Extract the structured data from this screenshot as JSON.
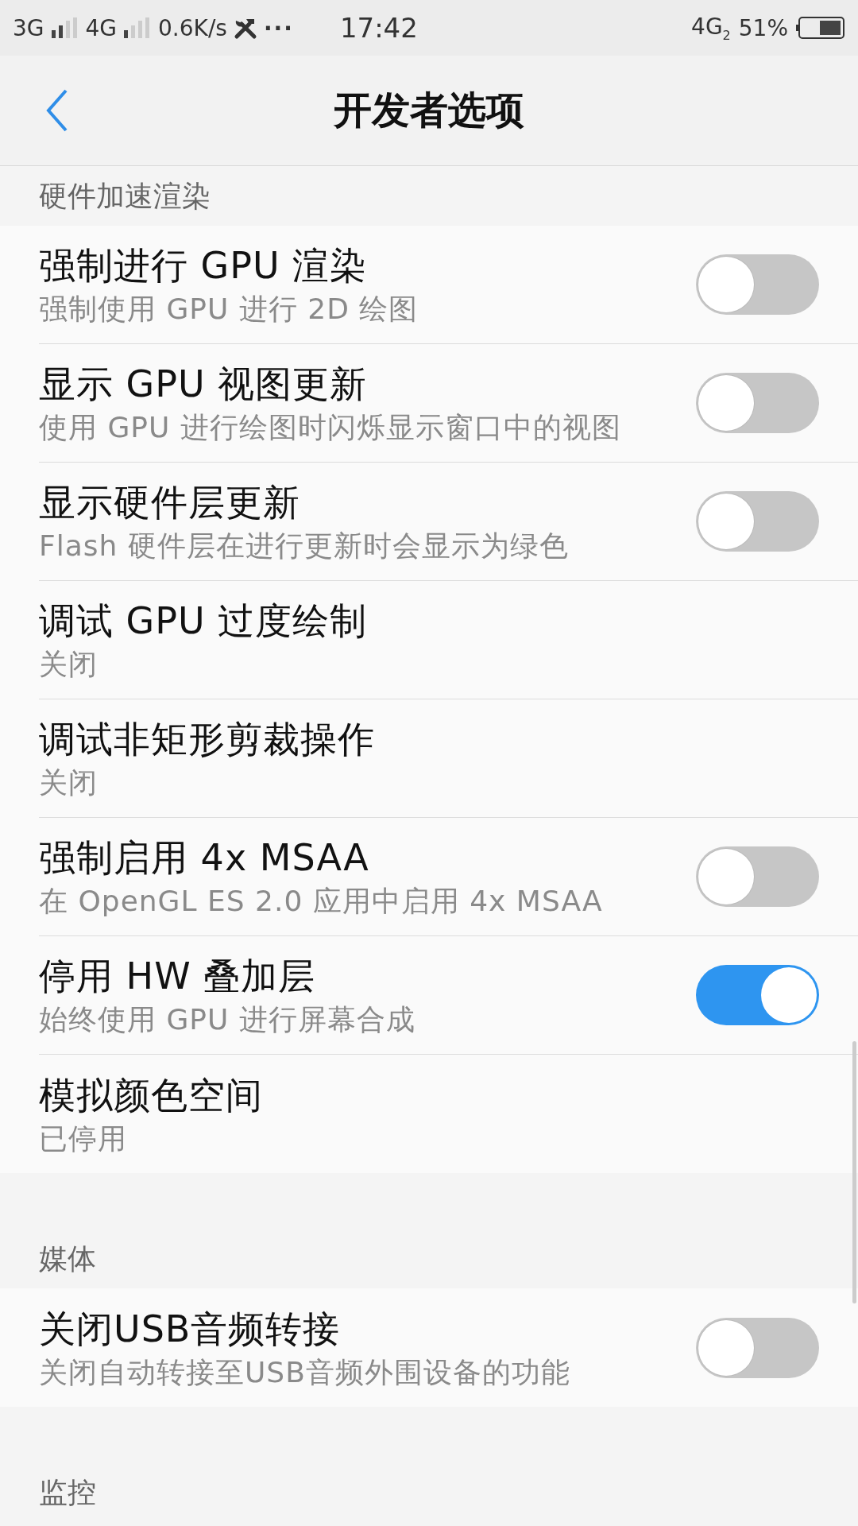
{
  "status_bar": {
    "network_1": "3G",
    "network_2": "4G",
    "speed": "0.6K/s",
    "more": "···",
    "time": "17:42",
    "network_3": "4G",
    "sim": "2",
    "battery": "51%"
  },
  "header": {
    "title": "开发者选项"
  },
  "sections": [
    {
      "title": "硬件加速渲染",
      "items": [
        {
          "kind": "toggle",
          "title": "强制进行 GPU 渲染",
          "subtitle": "强制使用 GPU 进行 2D 绘图",
          "on": false
        },
        {
          "kind": "toggle",
          "title": "显示 GPU 视图更新",
          "subtitle": "使用 GPU 进行绘图时闪烁显示窗口中的视图",
          "on": false
        },
        {
          "kind": "toggle",
          "title": "显示硬件层更新",
          "subtitle": "Flash 硬件层在进行更新时会显示为绿色",
          "on": false
        },
        {
          "kind": "value",
          "title": "调试 GPU 过度绘制",
          "subtitle": "关闭"
        },
        {
          "kind": "value",
          "title": "调试非矩形剪裁操作",
          "subtitle": "关闭"
        },
        {
          "kind": "toggle",
          "title": "强制启用 4x MSAA",
          "subtitle": "在 OpenGL ES 2.0 应用中启用 4x MSAA",
          "on": false
        },
        {
          "kind": "toggle",
          "title": "停用 HW 叠加层",
          "subtitle": "始终使用 GPU 进行屏幕合成",
          "on": true
        },
        {
          "kind": "value",
          "title": "模拟颜色空间",
          "subtitle": "已停用"
        }
      ]
    },
    {
      "title": "媒体",
      "items": [
        {
          "kind": "toggle",
          "title": "关闭USB音频转接",
          "subtitle": "关闭自动转接至USB音频外围设备的功能",
          "on": false
        }
      ]
    },
    {
      "title": "监控"
    }
  ]
}
